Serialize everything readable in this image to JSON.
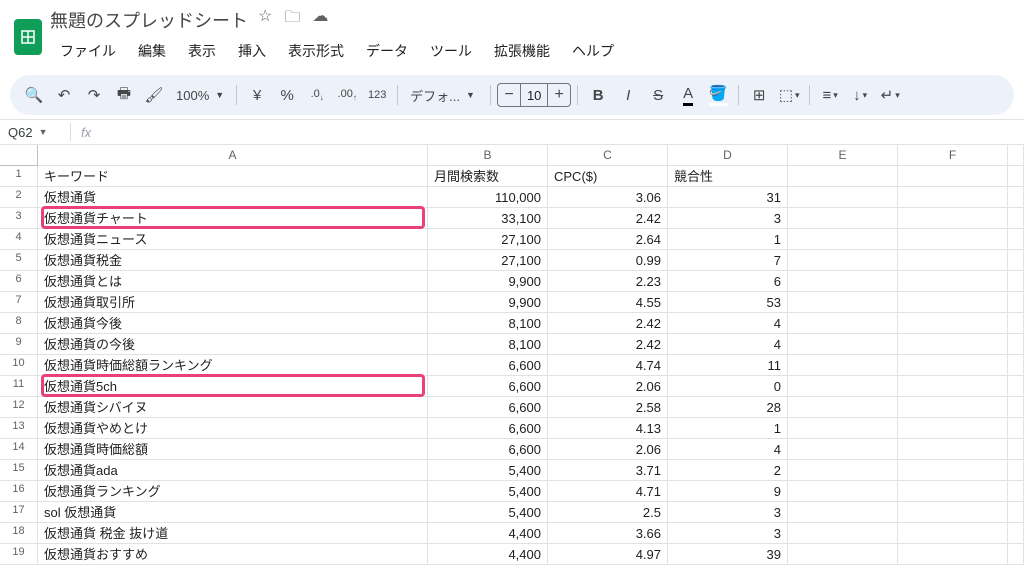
{
  "doc_title": "無題のスプレッドシート",
  "menus": [
    "ファイル",
    "編集",
    "表示",
    "挿入",
    "表示形式",
    "データ",
    "ツール",
    "拡張機能",
    "ヘルプ"
  ],
  "zoom": "100%",
  "currency": "¥",
  "percent": "%",
  "dec_dec": ".0",
  "dec_inc": ".00",
  "numfmt": "123",
  "font_name": "デフォ...",
  "font_size": "10",
  "name_box": "Q62",
  "columns": [
    "A",
    "B",
    "C",
    "D",
    "E",
    "F"
  ],
  "headers": {
    "a": "キーワード",
    "b": "月間検索数",
    "c": "CPC($)",
    "d": "競合性"
  },
  "rows": [
    {
      "n": 1,
      "a": "キーワード",
      "b": "月間検索数",
      "c": "CPC($)",
      "d": "競合性",
      "is_header": true
    },
    {
      "n": 2,
      "a": "仮想通貨",
      "b": "110,000",
      "c": "3.06",
      "d": "31"
    },
    {
      "n": 3,
      "a": "仮想通貨チャート",
      "b": "33,100",
      "c": "2.42",
      "d": "3"
    },
    {
      "n": 4,
      "a": "仮想通貨ニュース",
      "b": "27,100",
      "c": "2.64",
      "d": "1"
    },
    {
      "n": 5,
      "a": "仮想通貨税金",
      "b": "27,100",
      "c": "0.99",
      "d": "7"
    },
    {
      "n": 6,
      "a": "仮想通貨とは",
      "b": "9,900",
      "c": "2.23",
      "d": "6"
    },
    {
      "n": 7,
      "a": "仮想通貨取引所",
      "b": "9,900",
      "c": "4.55",
      "d": "53"
    },
    {
      "n": 8,
      "a": "仮想通貨今後",
      "b": "8,100",
      "c": "2.42",
      "d": "4"
    },
    {
      "n": 9,
      "a": "仮想通貨の今後",
      "b": "8,100",
      "c": "2.42",
      "d": "4"
    },
    {
      "n": 10,
      "a": "仮想通貨時価総額ランキング",
      "b": "6,600",
      "c": "4.74",
      "d": "11"
    },
    {
      "n": 11,
      "a": "仮想通貨5ch",
      "b": "6,600",
      "c": "2.06",
      "d": "0"
    },
    {
      "n": 12,
      "a": "仮想通貨シバイヌ",
      "b": "6,600",
      "c": "2.58",
      "d": "28"
    },
    {
      "n": 13,
      "a": "仮想通貨やめとけ",
      "b": "6,600",
      "c": "4.13",
      "d": "1"
    },
    {
      "n": 14,
      "a": "仮想通貨時価総額",
      "b": "6,600",
      "c": "2.06",
      "d": "4"
    },
    {
      "n": 15,
      "a": "仮想通貨ada",
      "b": "5,400",
      "c": "3.71",
      "d": "2"
    },
    {
      "n": 16,
      "a": "仮想通貨ランキング",
      "b": "5,400",
      "c": "4.71",
      "d": "9"
    },
    {
      "n": 17,
      "a": "sol 仮想通貨",
      "b": "5,400",
      "c": "2.5",
      "d": "3"
    },
    {
      "n": 18,
      "a": "仮想通貨 税金 抜け道",
      "b": "4,400",
      "c": "3.66",
      "d": "3"
    },
    {
      "n": 19,
      "a": "仮想通貨おすすめ",
      "b": "4,400",
      "c": "4.97",
      "d": "39"
    }
  ]
}
